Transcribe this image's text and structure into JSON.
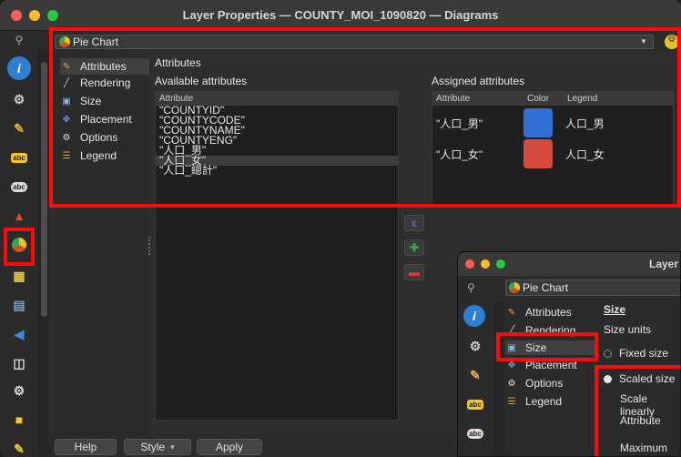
{
  "window": {
    "title": "Layer Properties — COUNTY_MOI_1090820 — Diagrams"
  },
  "search_icon": "search-icon",
  "renderer_dropdown": {
    "value": "Pie Chart"
  },
  "nav": {
    "items": [
      {
        "label": "Attributes",
        "icon": "attributes-icon"
      },
      {
        "label": "Rendering",
        "icon": "rendering-icon"
      },
      {
        "label": "Size",
        "icon": "size-icon"
      },
      {
        "label": "Placement",
        "icon": "placement-icon"
      },
      {
        "label": "Options",
        "icon": "options-icon"
      },
      {
        "label": "Legend",
        "icon": "legend-icon"
      }
    ]
  },
  "attributes": {
    "heading": "Attributes",
    "available_heading": "Available attributes",
    "assigned_heading": "Assigned attributes",
    "list_header": "Attribute",
    "available": [
      "\"COUNTYID\"",
      "\"COUNTYCODE\"",
      "\"COUNTYNAME\"",
      "\"COUNTYENG\"",
      "\"人口_男\"",
      "\"人口_女\"",
      "\"人口_總計\""
    ],
    "selected_index": 5,
    "assigned_columns": [
      "Attribute",
      "Color",
      "Legend"
    ],
    "assigned": [
      {
        "attribute": "\"人口_男\"",
        "color": "#2f6fd6",
        "legend": "人口_男"
      },
      {
        "attribute": "\"人口_女\"",
        "color": "#d64a3f",
        "legend": "人口_女"
      }
    ]
  },
  "bottom": {
    "help": "Help",
    "style": "Style",
    "apply": "Apply"
  },
  "sub_window": {
    "title": "Layer P",
    "dropdown": "Pie Chart",
    "nav": [
      "Attributes",
      "Rendering",
      "Size",
      "Placement",
      "Options",
      "Legend"
    ],
    "size_heading": "Size",
    "size_units": "Size units",
    "fixed_size": "Fixed size",
    "scaled_size": "Scaled size",
    "scale_linearly": "Scale linearly",
    "attribute_label": "Attribute",
    "maximum_value": "Maximum va",
    "abc_label": "abc"
  },
  "icons": {
    "sidebar_abc": "abc"
  },
  "colors": {
    "highlight": "#ff0a0a",
    "male": "#2f6fd6",
    "female": "#d64a3f"
  }
}
